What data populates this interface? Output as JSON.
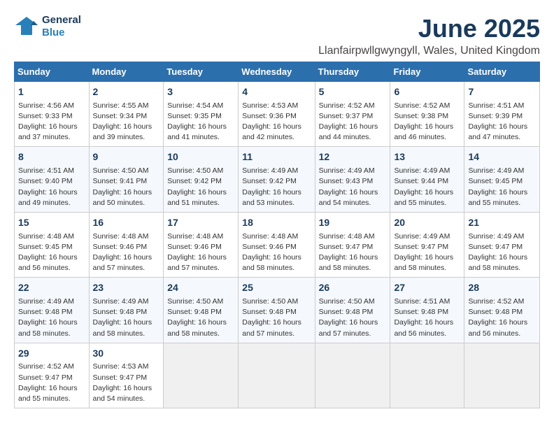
{
  "logo": {
    "line1": "General",
    "line2": "Blue"
  },
  "title": "June 2025",
  "location": "Llanfairpwllgwyngyll, Wales, United Kingdom",
  "header": {
    "days": [
      "Sunday",
      "Monday",
      "Tuesday",
      "Wednesday",
      "Thursday",
      "Friday",
      "Saturday"
    ]
  },
  "weeks": [
    [
      {
        "day": "1",
        "sunrise": "4:56 AM",
        "sunset": "9:33 PM",
        "daylight": "16 hours and 37 minutes."
      },
      {
        "day": "2",
        "sunrise": "4:55 AM",
        "sunset": "9:34 PM",
        "daylight": "16 hours and 39 minutes."
      },
      {
        "day": "3",
        "sunrise": "4:54 AM",
        "sunset": "9:35 PM",
        "daylight": "16 hours and 41 minutes."
      },
      {
        "day": "4",
        "sunrise": "4:53 AM",
        "sunset": "9:36 PM",
        "daylight": "16 hours and 42 minutes."
      },
      {
        "day": "5",
        "sunrise": "4:52 AM",
        "sunset": "9:37 PM",
        "daylight": "16 hours and 44 minutes."
      },
      {
        "day": "6",
        "sunrise": "4:52 AM",
        "sunset": "9:38 PM",
        "daylight": "16 hours and 46 minutes."
      },
      {
        "day": "7",
        "sunrise": "4:51 AM",
        "sunset": "9:39 PM",
        "daylight": "16 hours and 47 minutes."
      }
    ],
    [
      {
        "day": "8",
        "sunrise": "4:51 AM",
        "sunset": "9:40 PM",
        "daylight": "16 hours and 49 minutes."
      },
      {
        "day": "9",
        "sunrise": "4:50 AM",
        "sunset": "9:41 PM",
        "daylight": "16 hours and 50 minutes."
      },
      {
        "day": "10",
        "sunrise": "4:50 AM",
        "sunset": "9:42 PM",
        "daylight": "16 hours and 51 minutes."
      },
      {
        "day": "11",
        "sunrise": "4:49 AM",
        "sunset": "9:42 PM",
        "daylight": "16 hours and 53 minutes."
      },
      {
        "day": "12",
        "sunrise": "4:49 AM",
        "sunset": "9:43 PM",
        "daylight": "16 hours and 54 minutes."
      },
      {
        "day": "13",
        "sunrise": "4:49 AM",
        "sunset": "9:44 PM",
        "daylight": "16 hours and 55 minutes."
      },
      {
        "day": "14",
        "sunrise": "4:49 AM",
        "sunset": "9:45 PM",
        "daylight": "16 hours and 55 minutes."
      }
    ],
    [
      {
        "day": "15",
        "sunrise": "4:48 AM",
        "sunset": "9:45 PM",
        "daylight": "16 hours and 56 minutes."
      },
      {
        "day": "16",
        "sunrise": "4:48 AM",
        "sunset": "9:46 PM",
        "daylight": "16 hours and 57 minutes."
      },
      {
        "day": "17",
        "sunrise": "4:48 AM",
        "sunset": "9:46 PM",
        "daylight": "16 hours and 57 minutes."
      },
      {
        "day": "18",
        "sunrise": "4:48 AM",
        "sunset": "9:46 PM",
        "daylight": "16 hours and 58 minutes."
      },
      {
        "day": "19",
        "sunrise": "4:48 AM",
        "sunset": "9:47 PM",
        "daylight": "16 hours and 58 minutes."
      },
      {
        "day": "20",
        "sunrise": "4:49 AM",
        "sunset": "9:47 PM",
        "daylight": "16 hours and 58 minutes."
      },
      {
        "day": "21",
        "sunrise": "4:49 AM",
        "sunset": "9:47 PM",
        "daylight": "16 hours and 58 minutes."
      }
    ],
    [
      {
        "day": "22",
        "sunrise": "4:49 AM",
        "sunset": "9:48 PM",
        "daylight": "16 hours and 58 minutes."
      },
      {
        "day": "23",
        "sunrise": "4:49 AM",
        "sunset": "9:48 PM",
        "daylight": "16 hours and 58 minutes."
      },
      {
        "day": "24",
        "sunrise": "4:50 AM",
        "sunset": "9:48 PM",
        "daylight": "16 hours and 58 minutes."
      },
      {
        "day": "25",
        "sunrise": "4:50 AM",
        "sunset": "9:48 PM",
        "daylight": "16 hours and 57 minutes."
      },
      {
        "day": "26",
        "sunrise": "4:50 AM",
        "sunset": "9:48 PM",
        "daylight": "16 hours and 57 minutes."
      },
      {
        "day": "27",
        "sunrise": "4:51 AM",
        "sunset": "9:48 PM",
        "daylight": "16 hours and 56 minutes."
      },
      {
        "day": "28",
        "sunrise": "4:52 AM",
        "sunset": "9:48 PM",
        "daylight": "16 hours and 56 minutes."
      }
    ],
    [
      {
        "day": "29",
        "sunrise": "4:52 AM",
        "sunset": "9:47 PM",
        "daylight": "16 hours and 55 minutes."
      },
      {
        "day": "30",
        "sunrise": "4:53 AM",
        "sunset": "9:47 PM",
        "daylight": "16 hours and 54 minutes."
      },
      null,
      null,
      null,
      null,
      null
    ]
  ],
  "colors": {
    "header_bg": "#2c6fad",
    "title_color": "#1a3a5c"
  }
}
